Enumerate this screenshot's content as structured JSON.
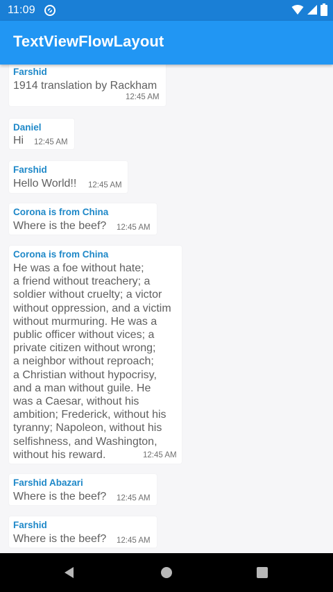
{
  "status_bar": {
    "time": "11:09",
    "sync_icon": "sync-icon",
    "wifi_icon": "wifi-icon",
    "signal_icon": "signal-icon",
    "battery_icon": "battery-icon"
  },
  "app_bar": {
    "title": "TextViewFlowLayout",
    "color": "#2196f3"
  },
  "messages": [
    {
      "sender": "Farshid",
      "text": "1914 translation by Rackham",
      "time": "12:45 AM"
    },
    {
      "sender": "Daniel",
      "text": "Hi",
      "time": "12:45 AM"
    },
    {
      "sender": "Farshid",
      "text": "Hello World!!",
      "time": "12:45 AM"
    },
    {
      "sender": "Corona is from China",
      "text": "Where is the beef?",
      "time": "12:45 AM"
    },
    {
      "sender": "Corona is from China",
      "lines": [
        "He was a foe without hate;",
        "a friend without treachery; a",
        "soldier without cruelty; a victor",
        "without oppression, and a victim",
        "without murmuring. He was a",
        "public officer without vices; a",
        "private citizen without wrong;",
        "a neighbor without reproach;",
        "a Christian without hypocrisy,",
        "and a man without guile. He",
        "was a Caesar, without his",
        "ambition; Frederick, without his",
        "tyranny; Napoleon, without his",
        "selfishness, and Washington,",
        "without his reward."
      ],
      "time": "12:45 AM"
    },
    {
      "sender": "Farshid Abazari",
      "text": "Where is the beef?",
      "time": "12:45 AM"
    },
    {
      "sender": "Farshid",
      "text": "Where is the beef?",
      "time": "12:45 AM"
    }
  ],
  "nav_bar": {
    "back_icon": "back-icon",
    "home_icon": "home-icon",
    "recents_icon": "recents-icon"
  }
}
